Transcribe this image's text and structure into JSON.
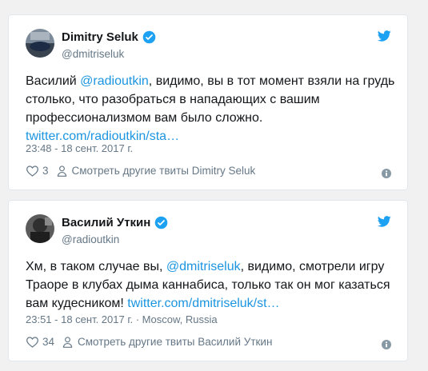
{
  "tweets": [
    {
      "display_name": "Dimitry Seluk",
      "handle": "@dmitriseluk",
      "text_before": "Василий ",
      "mention": "@radioutkin",
      "text_after": ", видимо, вы в тот момент взяли на грудь столько, что разобраться в нападающих с вашим профессионализмом вам было сложно. ",
      "link": "twitter.com/radioutkin/sta…",
      "timestamp": "23:48 - 18 сент. 2017 г.",
      "likes": "3",
      "see_more": "Смотреть другие твиты Dimitry Seluk",
      "avatar_icon": "profile-photo",
      "verified_icon": "verified-badge-icon"
    },
    {
      "display_name": "Василий Уткин",
      "handle": "@radioutkin",
      "text_before": "Хм, в таком случае вы, ",
      "mention": "@dmitriseluk",
      "text_after": ", видимо, смотрели игру Траоре в клубах дыма каннабиса, только так он мог казаться вам кудесником! ",
      "link": "twitter.com/dmitriseluk/st…",
      "timestamp": "23:51 - 18 сент. 2017 г. · Moscow, Russia",
      "likes": "34",
      "see_more": "Смотреть другие твиты Василий Уткин",
      "avatar_icon": "profile-photo",
      "verified_icon": "verified-badge-icon"
    }
  ],
  "colors": {
    "accent": "#1da1f2",
    "link": "#1b95e0",
    "text": "#14171a",
    "muted": "#657786",
    "background": "#f1f1f1"
  }
}
